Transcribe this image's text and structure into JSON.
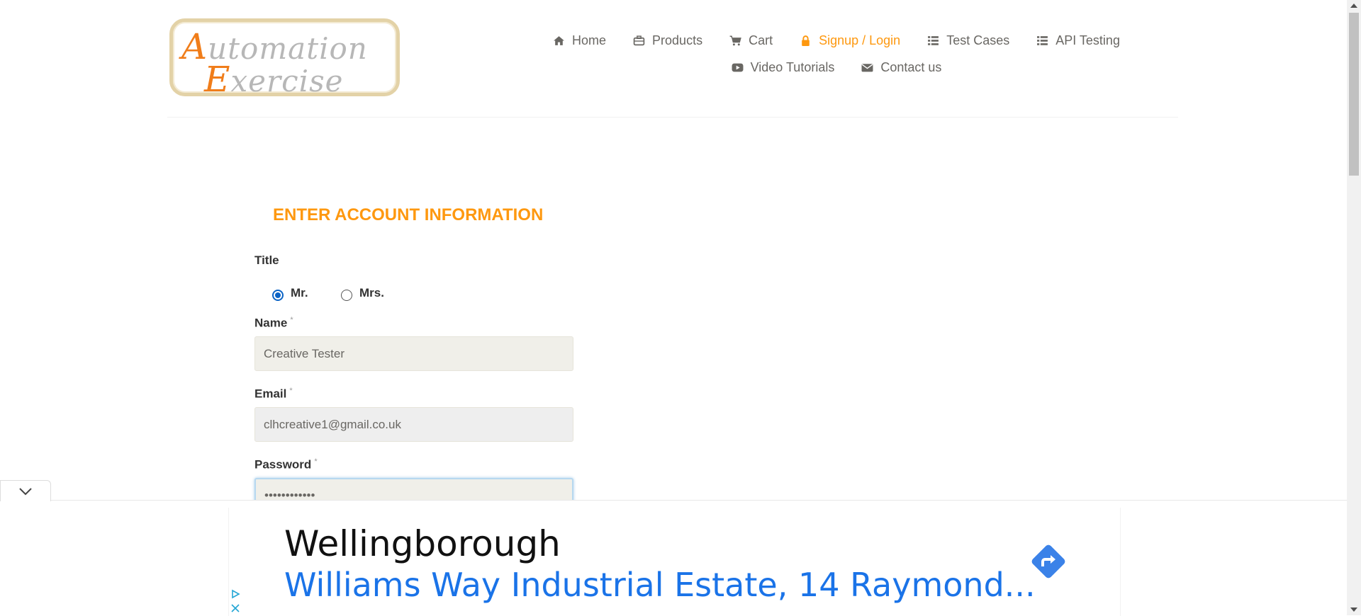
{
  "logo": {
    "line1_cap": "A",
    "line1_rest": "utomation",
    "line2_cap": "E",
    "line2_rest": "xercise"
  },
  "nav": {
    "items": [
      {
        "label": "Home",
        "icon": "home-icon"
      },
      {
        "label": "Products",
        "icon": "briefcase-icon"
      },
      {
        "label": "Cart",
        "icon": "cart-icon"
      },
      {
        "label": "Signup / Login",
        "icon": "lock-icon",
        "active": true
      },
      {
        "label": "Test Cases",
        "icon": "list-icon"
      },
      {
        "label": "API Testing",
        "icon": "list-icon"
      },
      {
        "label": "Video Tutorials",
        "icon": "youtube-play-icon"
      },
      {
        "label": "Contact us",
        "icon": "envelope-icon"
      }
    ]
  },
  "form": {
    "heading": "ENTER ACCOUNT INFORMATION",
    "title_label": "Title",
    "title_options": [
      {
        "label": "Mr.",
        "checked": true
      },
      {
        "label": "Mrs.",
        "checked": false
      }
    ],
    "name_label": "Name",
    "name_value": "Creative Tester",
    "email_label": "Email",
    "email_value": "clhcreative1@gmail.co.uk",
    "password_label": "Password",
    "password_value": "••••••••••••",
    "required_mark": "*"
  },
  "ad": {
    "title": "Wellingborough",
    "address": "Williams Way Industrial Estate, 14 Raymond..."
  },
  "colors": {
    "accent": "#FE980F",
    "ad_link": "#1A73E8",
    "radio": "#0B63C5",
    "text": "#696763"
  }
}
